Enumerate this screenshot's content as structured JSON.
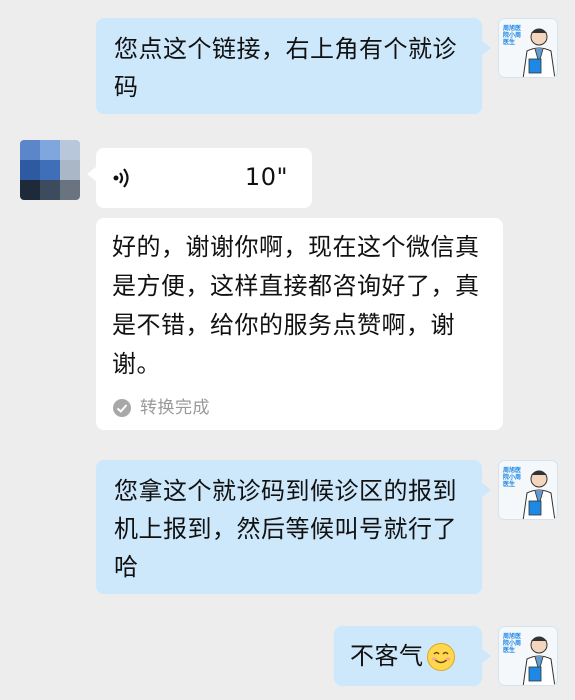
{
  "messages": {
    "m1": {
      "text": "您点这个链接，右上角有个就诊码"
    },
    "voice": {
      "duration": "10\""
    },
    "transcript": {
      "text": "好的，谢谢你啊，现在这个微信真是方便，这样直接都咨询好了，真是不错，给你的服务点赞啊，谢谢。",
      "status": "转换完成"
    },
    "m3": {
      "text": "您拿这个就诊码到候诊区的报到机上报到，然后等候叫号就行了哈"
    },
    "m4": {
      "text": "不客气"
    }
  },
  "avatar_doctor": {
    "tag": "周旭医院小周医生"
  },
  "colors": {
    "background": "#ededed",
    "outgoing_bubble": "#cde7fb",
    "incoming_bubble": "#ffffff",
    "status_gray": "#9a9a9a"
  },
  "icons": {
    "voice": "voice-wave-icon",
    "done": "check-circle-icon",
    "emoji": "smiling-face-emoji"
  }
}
